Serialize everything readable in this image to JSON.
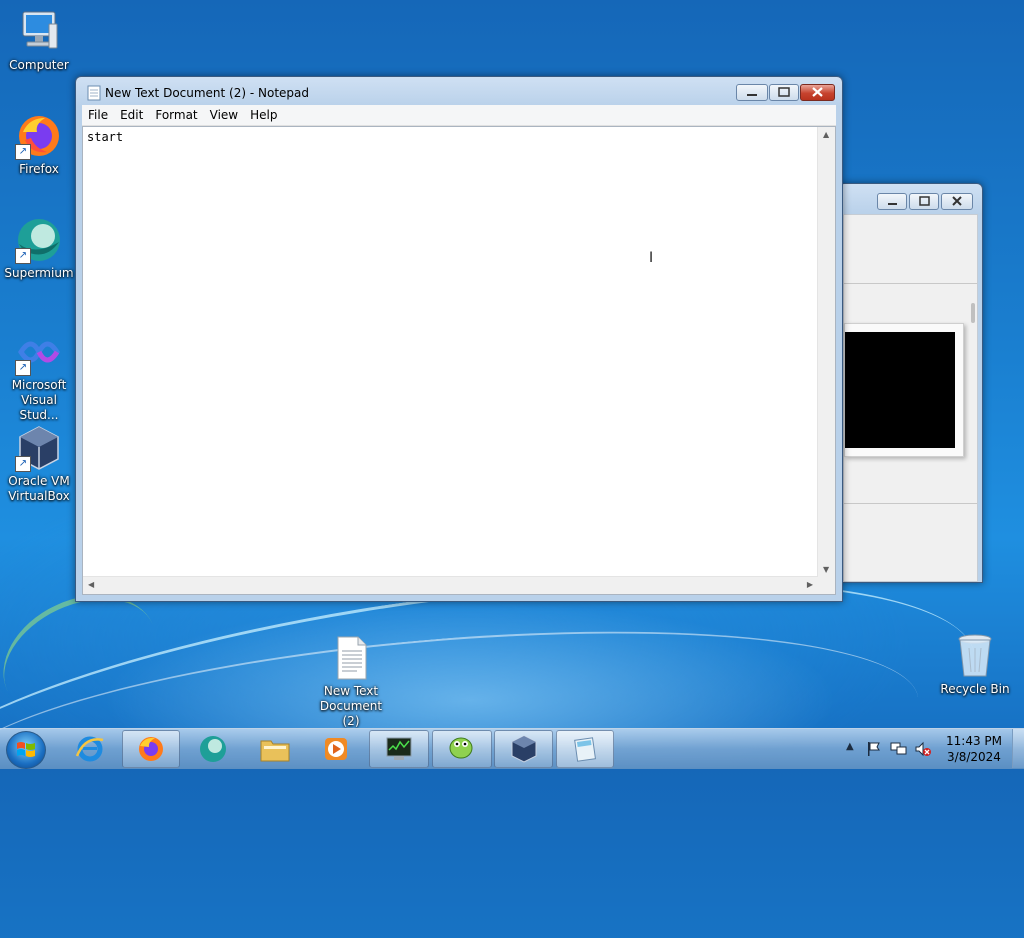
{
  "desktop": {
    "icons": [
      {
        "label": "Computer"
      },
      {
        "label": "Firefox"
      },
      {
        "label": "Supermium"
      },
      {
        "label": "Microsoft Visual Stud..."
      },
      {
        "label": "Oracle VM VirtualBox"
      },
      {
        "label": "New Text Document (2)"
      },
      {
        "label": "Recycle Bin"
      }
    ]
  },
  "notepad": {
    "title": "New Text Document (2) - Notepad",
    "menu": [
      "File",
      "Edit",
      "Format",
      "View",
      "Help"
    ],
    "content": "start"
  },
  "taskbar": {
    "pinned": [
      "Internet Explorer",
      "Firefox",
      "Supermium",
      "Windows Explorer",
      "Windows Media Player"
    ],
    "running": [
      "Task Manager",
      "Notepad++",
      "Oracle VM VirtualBox",
      "Notepad"
    ],
    "clock": {
      "time": "11:43 PM",
      "date": "3/8/2024"
    }
  }
}
